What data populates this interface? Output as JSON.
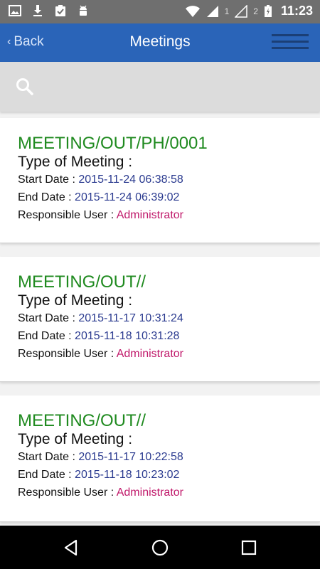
{
  "status_bar": {
    "sim1": "1",
    "sim2": "2",
    "time": "11:23",
    "icons": [
      "image-icon",
      "download-icon",
      "clipboard-check-icon",
      "android-icon",
      "wifi-icon",
      "signal-icon",
      "signal-icon",
      "battery-charging-icon"
    ]
  },
  "header": {
    "back_label": "Back",
    "title": "Meetings",
    "menu_icon": "hamburger-menu-icon"
  },
  "search": {
    "icon": "search-icon"
  },
  "labels": {
    "type": "Type of Meeting :",
    "start": "Start Date : ",
    "end": "End Date : ",
    "responsible": "Responsible User : "
  },
  "meetings": [
    {
      "title": "MEETING/OUT/PH/0001",
      "start": "2015-11-24 06:38:58",
      "end": "2015-11-24 06:39:02",
      "user": "Administrator"
    },
    {
      "title": "MEETING/OUT//",
      "start": "2015-11-17 10:31:24",
      "end": "2015-11-18 10:31:28",
      "user": "Administrator"
    },
    {
      "title": "MEETING/OUT//",
      "start": "2015-11-17 10:22:58",
      "end": "2015-11-18 10:23:02",
      "user": "Administrator"
    }
  ],
  "colors": {
    "appbar": "#2a64b8",
    "title_green": "#1f8a1f",
    "date_blue": "#2a3a8f",
    "user_pink": "#c0186a"
  },
  "nav": [
    "back-triangle-icon",
    "home-circle-icon",
    "recents-square-icon"
  ]
}
